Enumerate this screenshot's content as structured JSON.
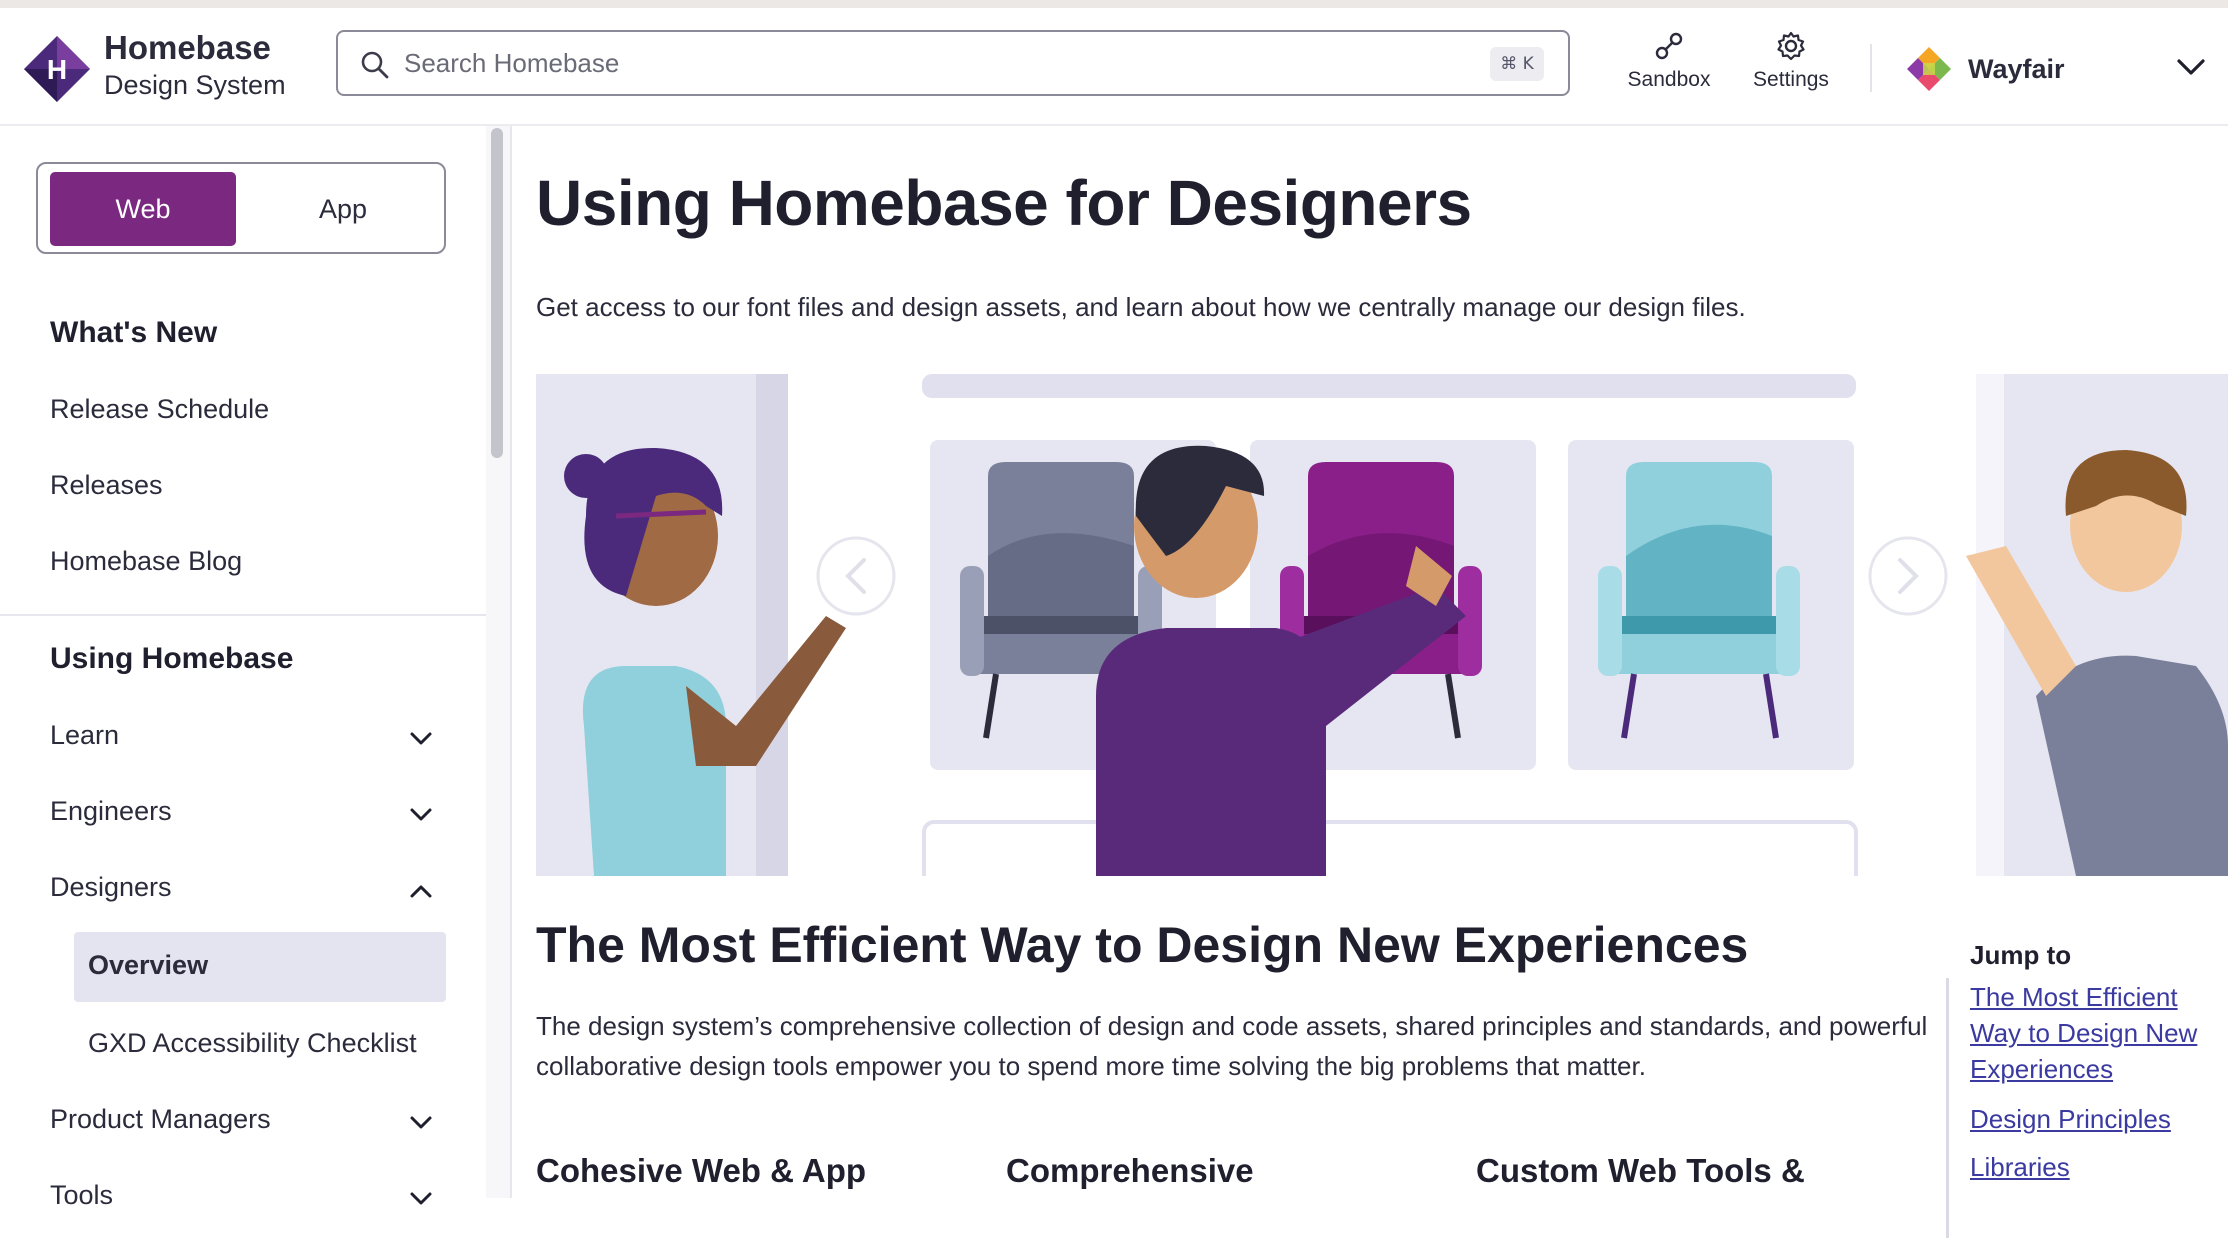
{
  "header": {
    "brand_name": "Homebase",
    "brand_sub": "Design System",
    "search_placeholder": "Search Homebase",
    "search_shortcut": "⌘ K",
    "sandbox_label": "Sandbox",
    "settings_label": "Settings",
    "tenant_name": "Wayfair"
  },
  "sidebar": {
    "platform_toggle": {
      "active": "Web",
      "inactive": "App"
    },
    "section_whats_new": "What's New",
    "whats_new_items": [
      "Release Schedule",
      "Releases",
      "Homebase Blog"
    ],
    "section_using": "Using Homebase",
    "using_items": [
      {
        "label": "Learn",
        "expanded": false
      },
      {
        "label": "Engineers",
        "expanded": false
      },
      {
        "label": "Designers",
        "expanded": true
      },
      {
        "label": "Product Managers",
        "expanded": false
      },
      {
        "label": "Tools",
        "expanded": false
      }
    ],
    "designers_subitems": [
      "Overview",
      "GXD Accessibility Checklist"
    ]
  },
  "main": {
    "title": "Using Homebase for Designers",
    "lede": "Get access to our font files and design assets, and learn about how we centrally manage our design files.",
    "section_title": "The Most Efficient Way to Design New Experiences",
    "section_text": "The design system’s comprehensive collection of design and code assets, shared principles and standards, and powerful collaborative design tools empower you to spend more time solving the big problems that matter.",
    "columns": [
      "Cohesive Web & App",
      "Comprehensive",
      "Custom Web Tools &"
    ]
  },
  "jump_to": {
    "title": "Jump to",
    "links": [
      "The Most Efficient Way to Design New Experiences",
      "Design Principles",
      "Libraries"
    ]
  },
  "colors": {
    "brand_purple": "#7a2880",
    "link": "#3a3aa0",
    "active_nav_bg": "#e4e4f0"
  }
}
